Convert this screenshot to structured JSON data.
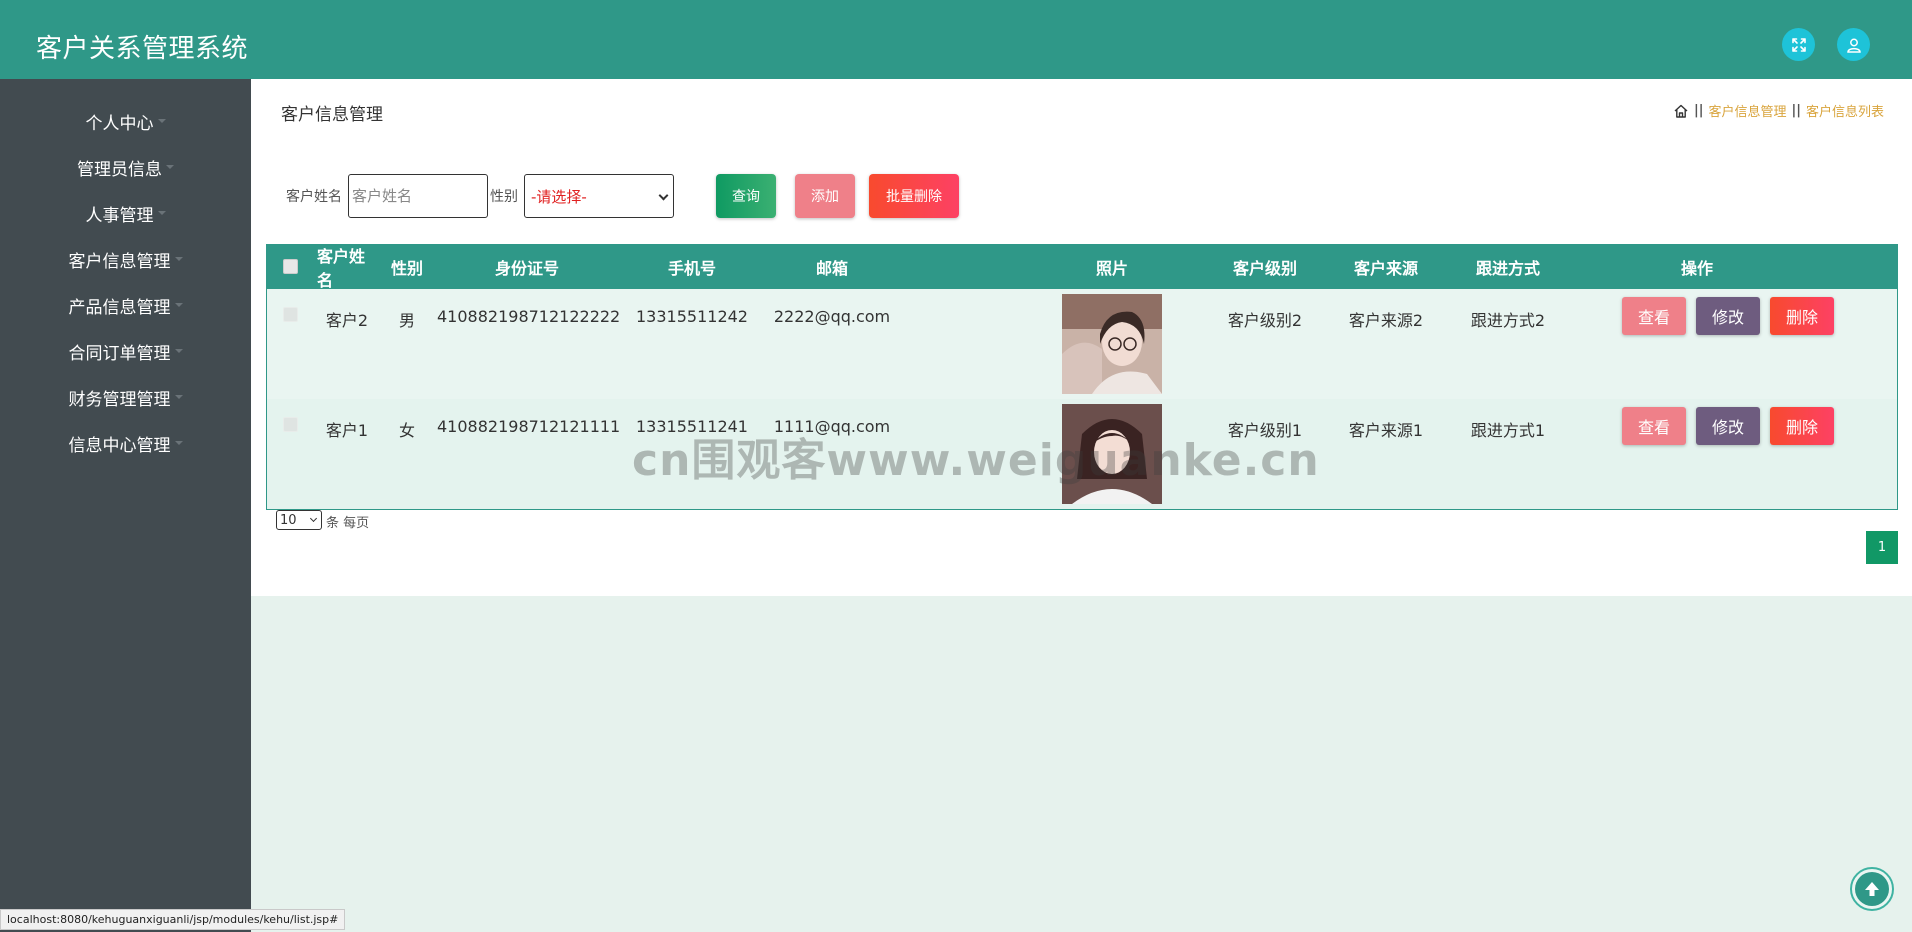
{
  "app": {
    "title": "客户关系管理系统"
  },
  "header": {
    "fullscreen_icon": "fullscreen-icon",
    "user_icon": "user-icon"
  },
  "sidebar": {
    "items": [
      {
        "label": "个人中心"
      },
      {
        "label": "管理员信息"
      },
      {
        "label": "人事管理"
      },
      {
        "label": "客户信息管理"
      },
      {
        "label": "产品信息管理"
      },
      {
        "label": "合同订单管理"
      },
      {
        "label": "财务管理管理"
      },
      {
        "label": "信息中心管理"
      }
    ]
  },
  "page": {
    "title": "客户信息管理"
  },
  "breadcrumb": {
    "sep": "||",
    "items": [
      "客户信息管理",
      "客户信息列表"
    ]
  },
  "search": {
    "name_label": "客户姓名",
    "name_placeholder": "客户姓名",
    "name_value": "",
    "sex_label": "性别",
    "sex_selected": "-请选择-",
    "query_label": "查询",
    "add_label": "添加",
    "batch_delete_label": "批量删除"
  },
  "table": {
    "headers": [
      "客户姓名",
      "性别",
      "身份证号",
      "手机号",
      "邮箱",
      "照片",
      "客户级别",
      "客户来源",
      "跟进方式",
      "操作"
    ],
    "rows": [
      {
        "name": "客户2",
        "sex": "男",
        "id_card": "410882198712122222",
        "phone": "13315511242",
        "email": "2222@qq.com",
        "level": "客户级别2",
        "source": "客户来源2",
        "follow": "跟进方式2"
      },
      {
        "name": "客户1",
        "sex": "女",
        "id_card": "410882198712121111",
        "phone": "13315511241",
        "email": "1111@qq.com",
        "level": "客户级别1",
        "source": "客户来源1",
        "follow": "跟进方式1"
      }
    ],
    "actions": {
      "view": "查看",
      "edit": "修改",
      "delete": "删除"
    }
  },
  "pagination": {
    "page_size": "10",
    "per_page_label": "条 每页",
    "current_page": "1"
  },
  "watermark": "cn围观客www.weiguanke.cn",
  "status_bar": {
    "url": "localhost:8080/kehuguanxiguanli/jsp/modules/kehu/list.jsp#"
  },
  "colors": {
    "header": "#2f9888",
    "sidebar": "#424b50",
    "accent": "#2f9888",
    "breadcrumb": "#d9a43c"
  }
}
